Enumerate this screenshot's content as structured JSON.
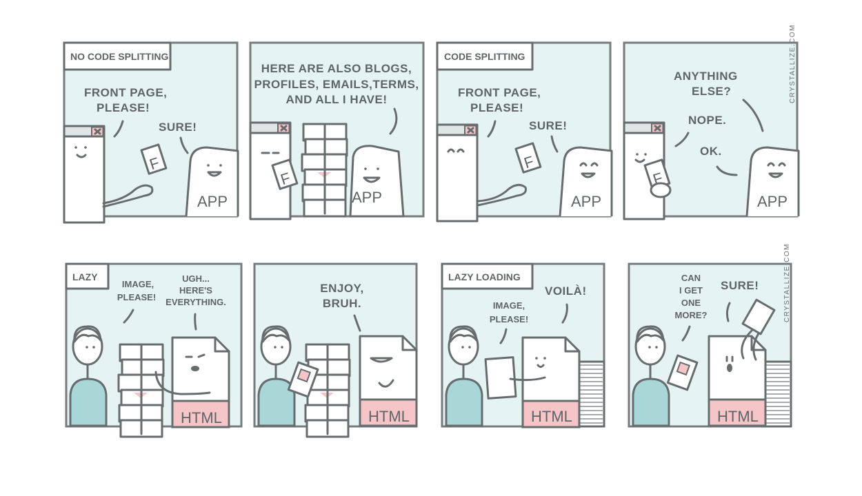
{
  "colors": {
    "panel_bg": "#e5f3f3",
    "ink": "#676c6e",
    "accent_pink": "#f6c5c8",
    "shirt_teal": "#a9d6d6"
  },
  "watermark": "CRYSTALLIZE.COM",
  "top_row": {
    "panel1": {
      "label": "NO CODE SPLITTING",
      "speech1": [
        "FRONT PAGE,",
        "PLEASE!"
      ],
      "speech2": "SURE!",
      "paper_letter": "F",
      "app_label": "APP"
    },
    "panel2": {
      "speech": [
        "HERE ARE ALSO BLOGS,",
        "PROFILES, EMAILS,TERMS,",
        "AND ALL I HAVE!"
      ],
      "paper_letter": "F",
      "app_label": "APP"
    },
    "panel3": {
      "label": "CODE SPLITTING",
      "speech1": [
        "FRONT PAGE,",
        "PLEASE!"
      ],
      "speech2": "SURE!",
      "paper_letter": "F",
      "app_label": "APP"
    },
    "panel4": {
      "speech1": [
        "ANYTHING",
        "ELSE?"
      ],
      "speech2": "NOPE.",
      "speech3": "OK.",
      "paper_letter": "F",
      "app_label": "APP"
    }
  },
  "bottom_row": {
    "panel1": {
      "label": "LAZY",
      "speech1": [
        "IMAGE,",
        "PLEASE!"
      ],
      "speech2": [
        "UGH...",
        "HERE'S",
        "EVERYTHING."
      ],
      "html_label": "HTML"
    },
    "panel2": {
      "speech": [
        "ENJOY,",
        "BRUH."
      ],
      "html_label": "HTML"
    },
    "panel3": {
      "label": "LAZY LOADING",
      "speech1": "VOILÀ!",
      "speech2": [
        "IMAGE,",
        "PLEASE!"
      ],
      "html_label": "HTML"
    },
    "panel4": {
      "speech1": [
        "CAN",
        "I GET",
        "ONE",
        "MORE?"
      ],
      "speech2": "SURE!",
      "html_label": "HTML"
    }
  }
}
